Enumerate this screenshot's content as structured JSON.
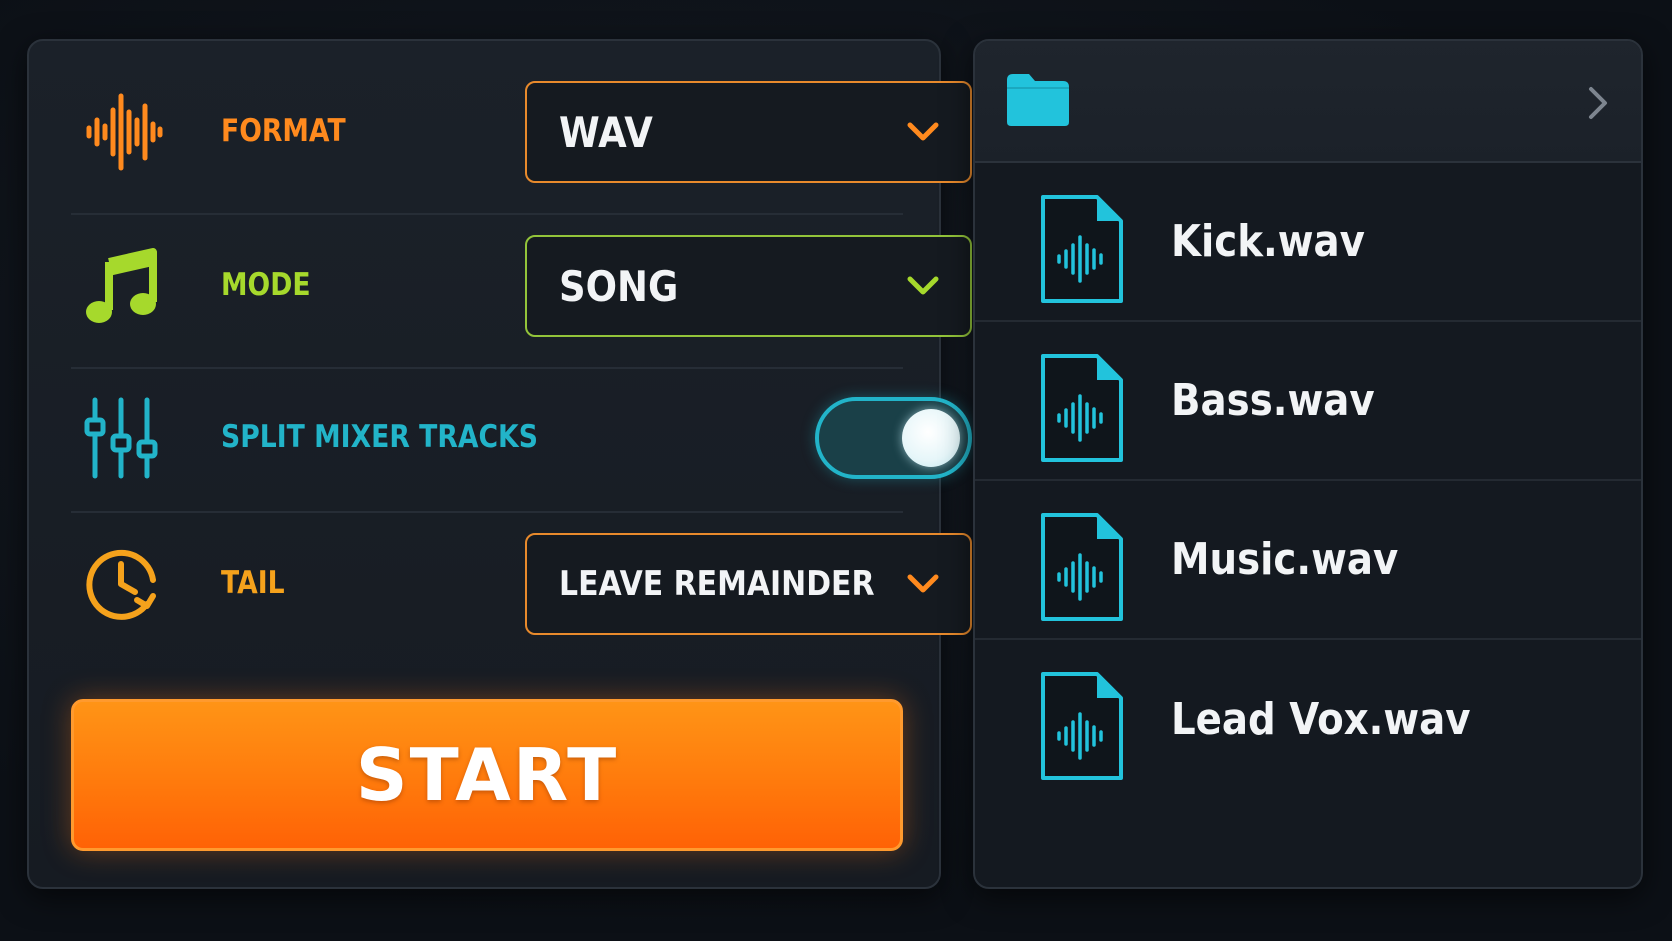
{
  "export_settings": {
    "format": {
      "label": "FORMAT",
      "value": "WAV",
      "icon": "waveform-icon",
      "color": "#ff8a1e"
    },
    "mode": {
      "label": "MODE",
      "value": "SONG",
      "icon": "music-note-icon",
      "color": "#a6d92c"
    },
    "split_mixer_tracks": {
      "label": "SPLIT MIXER TRACKS",
      "enabled": true,
      "icon": "mixer-sliders-icon",
      "color": "#22b4c9"
    },
    "tail": {
      "label": "TAIL",
      "value": "LEAVE REMAINDER",
      "icon": "clock-icon",
      "color": "#f5a21c"
    },
    "start_button": {
      "label": "START",
      "color": "#ff7a0c"
    }
  },
  "file_browser": {
    "header_icon": "folder-icon",
    "nav_icon": "chevron-right-icon",
    "accent": "#22c3dc",
    "files": [
      {
        "name": "Kick.wav",
        "icon": "audio-file-icon"
      },
      {
        "name": "Bass.wav",
        "icon": "audio-file-icon"
      },
      {
        "name": "Music.wav",
        "icon": "audio-file-icon"
      },
      {
        "name": "Lead Vox.wav",
        "icon": "audio-file-icon"
      }
    ]
  }
}
